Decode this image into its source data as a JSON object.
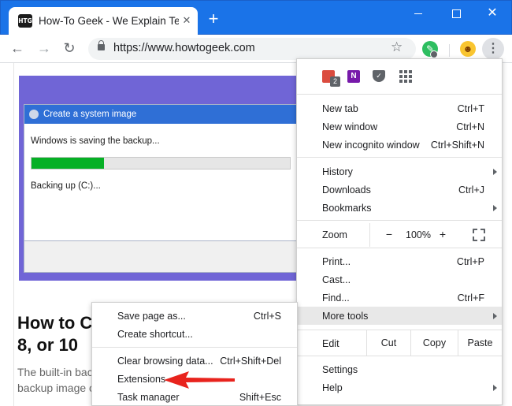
{
  "window": {
    "tab_title": "How-To Geek - We Explain Technology",
    "tab_favicon": "HTG",
    "close_tab": "✕",
    "new_tab": "+",
    "close_window": "✕"
  },
  "toolbar": {
    "url": "https://www.howtogeek.com",
    "back": "←",
    "forward": "→",
    "reload": "↻",
    "star": "☆",
    "menu": "⋮",
    "avatar_emoji": "☻",
    "evernote": "✎"
  },
  "page": {
    "dialog_title": "Create a system image",
    "dialog_text": "Windows is saving the backup...",
    "dialog_progress": 0.28,
    "dialog_sub": "Backing up (C:)...",
    "article_title_line1": "How to C",
    "article_title_line2": "8, or 10",
    "article_body_line1": "The built-in bac",
    "article_body_line2": "backup image o"
  },
  "menu_icons": {
    "todoist_badge": "2",
    "onenote": "N",
    "pocket": "✓"
  },
  "menu": {
    "new_tab": {
      "label": "New tab",
      "shortcut": "Ctrl+T"
    },
    "new_window": {
      "label": "New window",
      "shortcut": "Ctrl+N"
    },
    "incognito": {
      "label": "New incognito window",
      "shortcut": "Ctrl+Shift+N"
    },
    "history": {
      "label": "History"
    },
    "downloads": {
      "label": "Downloads",
      "shortcut": "Ctrl+J"
    },
    "bookmarks": {
      "label": "Bookmarks"
    },
    "zoom": {
      "label": "Zoom",
      "minus": "−",
      "value": "100%",
      "plus": "+"
    },
    "print": {
      "label": "Print...",
      "shortcut": "Ctrl+P"
    },
    "cast": {
      "label": "Cast..."
    },
    "find": {
      "label": "Find...",
      "shortcut": "Ctrl+F"
    },
    "more_tools": {
      "label": "More tools"
    },
    "edit": {
      "label": "Edit",
      "cut": "Cut",
      "copy": "Copy",
      "paste": "Paste"
    },
    "settings": {
      "label": "Settings"
    },
    "help": {
      "label": "Help"
    }
  },
  "submenu": {
    "save_page": {
      "label": "Save page as...",
      "shortcut": "Ctrl+S"
    },
    "create_shortcut": {
      "label": "Create shortcut..."
    },
    "clear_data": {
      "label": "Clear browsing data...",
      "shortcut": "Ctrl+Shift+Del"
    },
    "extensions": {
      "label": "Extensions"
    },
    "task_manager": {
      "label": "Task manager",
      "shortcut": "Shift+Esc"
    }
  },
  "colors": {
    "titlebar": "#1a73e8",
    "highlight_row": "#e8e8e8",
    "annotation_arrow": "#e8231d",
    "progress_green": "#06b025"
  }
}
